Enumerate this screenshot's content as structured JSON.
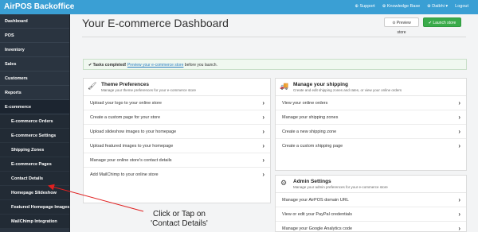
{
  "topbar": {
    "brand": "AirPOS Backoffice",
    "links": [
      {
        "icon": "support-icon",
        "label": "⊕ Support"
      },
      {
        "icon": "book-icon",
        "label": "⊕ Knowledge Base"
      },
      {
        "icon": "user-icon",
        "label": "⊕ Daibhi ▾"
      },
      {
        "icon": "logout-icon",
        "label": "Logout"
      }
    ]
  },
  "sidebar": {
    "items": [
      {
        "label": "Dashboard",
        "sub": false
      },
      {
        "label": "POS",
        "sub": false
      },
      {
        "label": "Inventory",
        "sub": false
      },
      {
        "label": "Sales",
        "sub": false
      },
      {
        "label": "Customers",
        "sub": false
      },
      {
        "label": "Reports",
        "sub": false
      },
      {
        "label": "E-commerce",
        "sub": false
      },
      {
        "label": "E-commerce Orders",
        "sub": true
      },
      {
        "label": "E-commerce Settings",
        "sub": true
      },
      {
        "label": "Shipping Zones",
        "sub": true
      },
      {
        "label": "E-commerce Pages",
        "sub": true
      },
      {
        "label": "Contact Details",
        "sub": true
      },
      {
        "label": "Homepage Slideshow",
        "sub": true
      },
      {
        "label": "Featured Homepage Images",
        "sub": true
      },
      {
        "label": "MailChimp Integration",
        "sub": true
      }
    ]
  },
  "header": {
    "title": "Your E-commerce Dashboard",
    "preview_label": "⊙ Preview store",
    "launch_label": "✔ Launch store"
  },
  "alert": {
    "bold": "✔ Tasks completed!",
    "link": "Preview your e-commerce store",
    "rest": " before you launch."
  },
  "theme_card": {
    "title": "Theme Preferences",
    "subtitle": "Manage your theme preferences for your e-commerce store",
    "rows": [
      "Upload your logo to your online store",
      "Create a custom page for your store",
      "Upload slideshow images to your homepage",
      "Upload featured images to your homepage",
      "Manage your online store's contact details",
      "Add MailChimp to your online store"
    ]
  },
  "shipping_card": {
    "title": "Manage your shipping",
    "subtitle": "Create and edit shipping zones and rates, or view your online orders",
    "rows": [
      "View your online orders",
      "Manage your shipping zones",
      "Create a new shipping zone",
      "Create a custom shipping page"
    ]
  },
  "admin_card": {
    "title": "Admin Settings",
    "subtitle": "Manage your admin preferences for your e-commerce store",
    "rows": [
      "Manage your AirPOS domain URL",
      "View or edit your PayPal credentials",
      "Manage your Google Analytics code"
    ]
  },
  "annotation": {
    "line1": "Click or Tap on",
    "line2": "'Contact Details'"
  },
  "colors": {
    "topbar": "#3a9fd4",
    "sidebar": "#2a3440",
    "launch": "#3aab4a",
    "arrow": "#e02020"
  }
}
